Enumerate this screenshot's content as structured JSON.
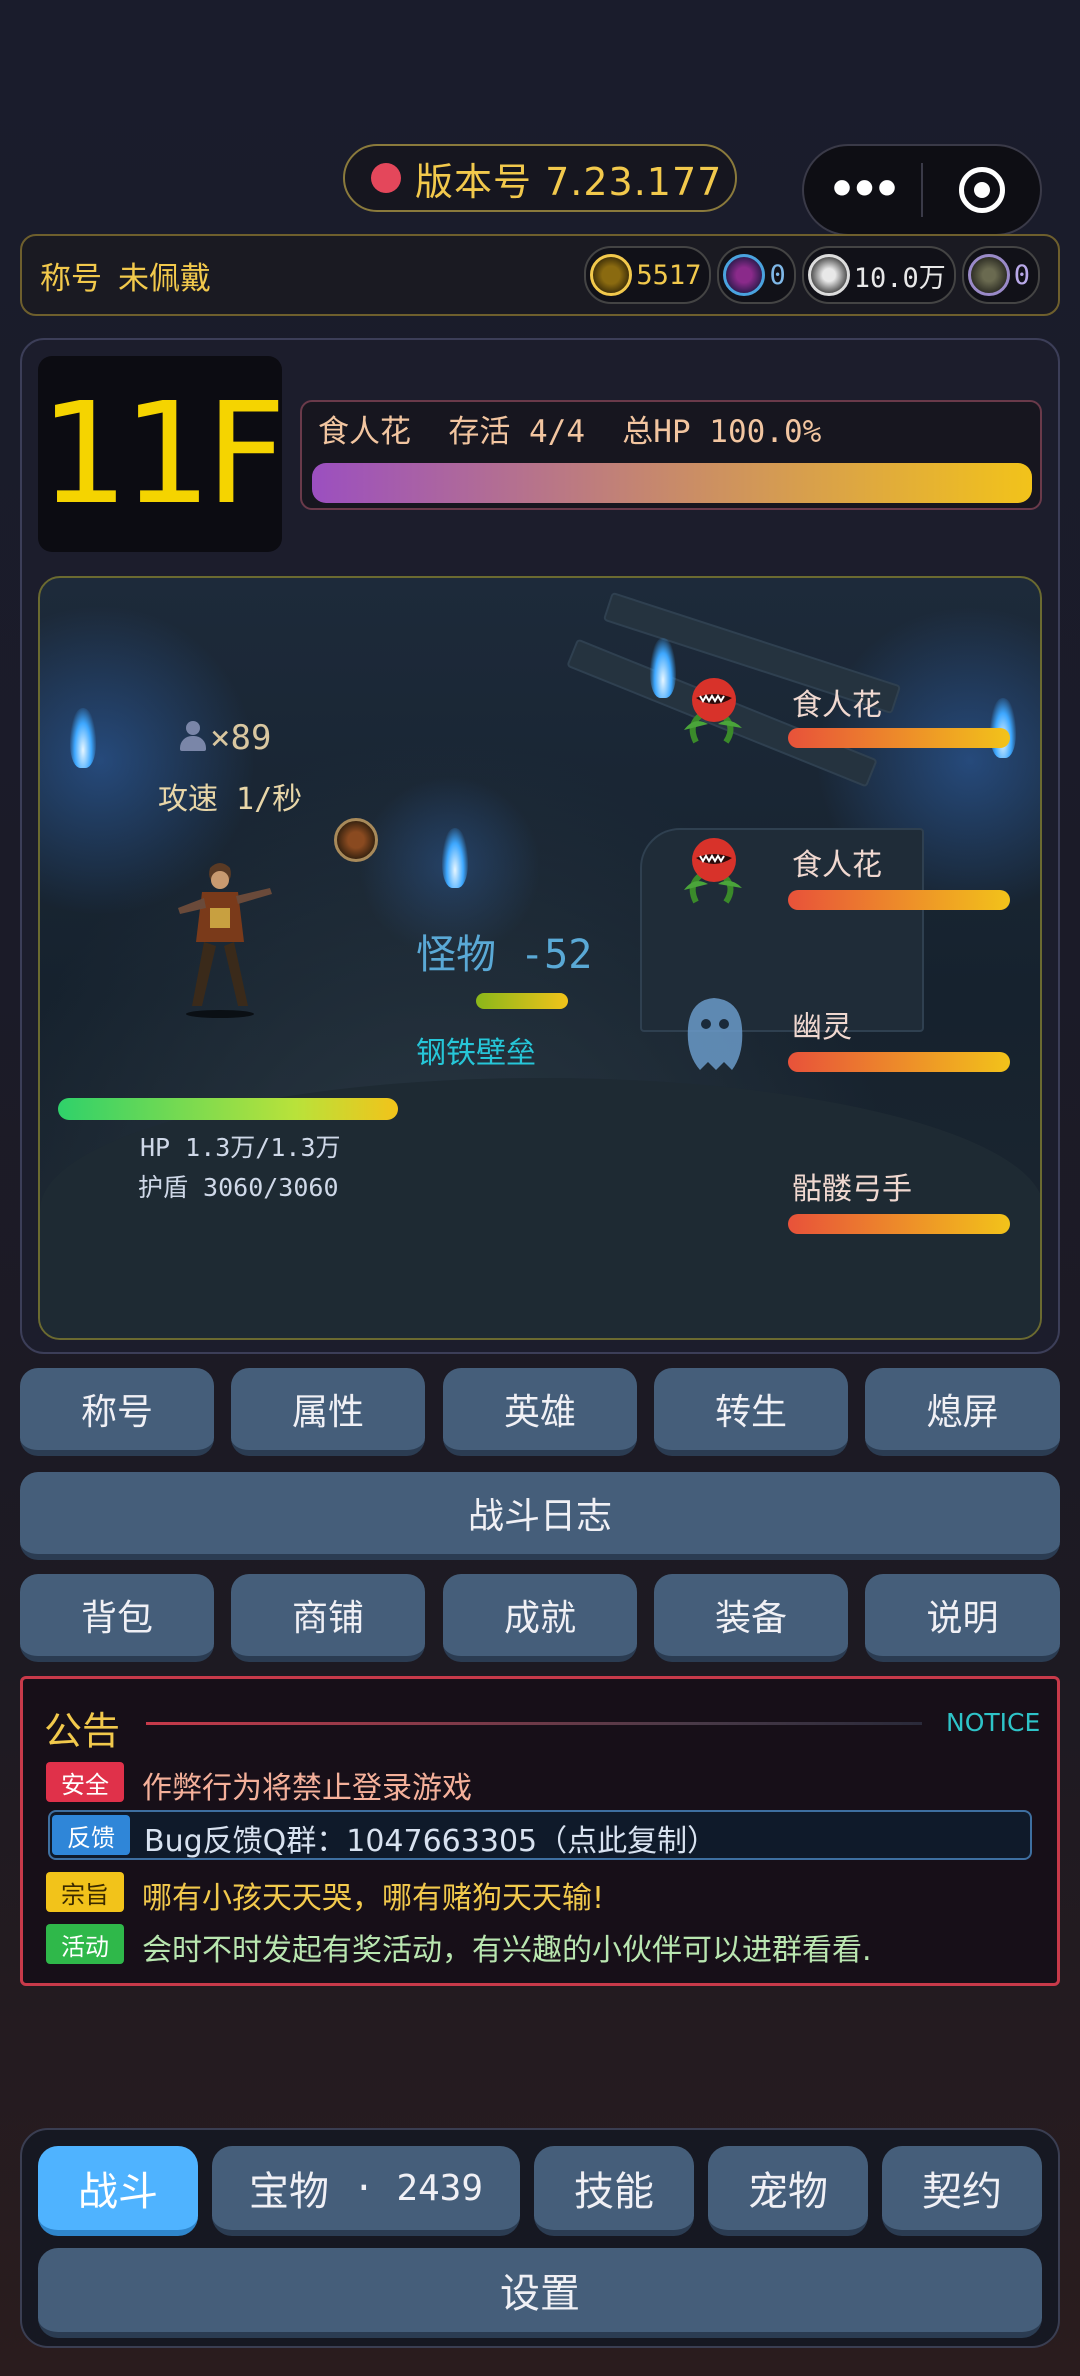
{
  "header": {
    "version_label": "版本号",
    "version_value": "7.23.177"
  },
  "title_bar": {
    "label": "称号",
    "value": "未佩戴",
    "currencies": [
      {
        "icon": "gold-coin-icon",
        "value": "5517"
      },
      {
        "icon": "purple-gem-icon",
        "value": "0"
      },
      {
        "icon": "silver-ore-icon",
        "value": "10.0万"
      },
      {
        "icon": "dark-fragment-icon",
        "value": "0"
      }
    ]
  },
  "floor": {
    "label": "11F"
  },
  "boss": {
    "info": "食人花  存活 4/4  总HP 100.0%",
    "hp_fraction": 1.0
  },
  "battle": {
    "hero_count": "×89",
    "attack_speed": "攻速 1/秒",
    "damage_text": "怪物 -52",
    "shield_skill": "钢铁壁垒",
    "hero_hp": "HP 1.3万/1.3万",
    "hero_shield": "护盾 3060/3060",
    "hero_hp_fraction": 1.0,
    "enemies": [
      {
        "name": "食人花",
        "icon": "man-eating-flower-icon",
        "hp_fraction": 1.0
      },
      {
        "name": "食人花",
        "icon": "man-eating-flower-icon",
        "hp_fraction": 1.0
      },
      {
        "name": "幽灵",
        "icon": "ghost-icon",
        "hp_fraction": 1.0
      },
      {
        "name": "骷髅弓手",
        "icon": "skeleton-archer-icon",
        "hp_fraction": 1.0
      }
    ]
  },
  "menu_row1": [
    "称号",
    "属性",
    "英雄",
    "转生",
    "熄屏"
  ],
  "battle_log": "战斗日志",
  "menu_row2": [
    "背包",
    "商铺",
    "成就",
    "装备",
    "说明"
  ],
  "notice": {
    "title": "公告",
    "title_en": "NOTICE",
    "items": [
      {
        "tag": "安全",
        "text": "作弊行为将禁止登录游戏",
        "tag_color": "#e0314a",
        "text_color": "#f5b09a"
      },
      {
        "tag": "反馈",
        "text": "Bug反馈Q群：1047663305（点此复制）",
        "tag_color": "#2f86d8",
        "text_color": "#d8e2f0"
      },
      {
        "tag": "宗旨",
        "text": "哪有小孩天天哭，哪有赌狗天天输!",
        "tag_color": "#f2c31a",
        "text_color": "#f2c94c"
      },
      {
        "tag": "活动",
        "text": "会时不时发起有奖活动，有兴趣的小伙伴可以进群看看.",
        "tag_color": "#2fb84a",
        "text_color": "#b9e6b0"
      }
    ]
  },
  "tabs": {
    "battle": "战斗",
    "treasure": "宝物",
    "treasure_badge": "· 2439",
    "skills": "技能",
    "pets": "宠物",
    "contract": "契约",
    "settings": "设置"
  },
  "colors": {
    "accent_gold": "#f2c94c",
    "active_tab": "#4fb3ff",
    "button_blue": "#455e7a",
    "notice_border": "#c83a4a"
  }
}
